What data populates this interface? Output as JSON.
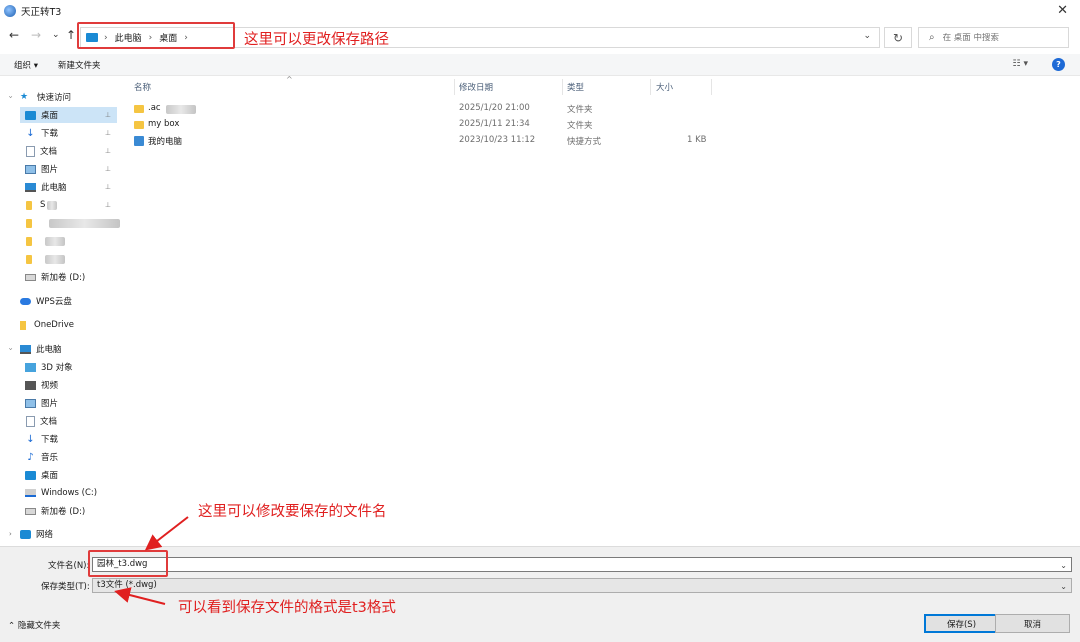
{
  "window": {
    "title": "天正转T3",
    "close_glyph": "✕"
  },
  "nav": {
    "back": "←",
    "forward": "→",
    "recent": "⌄",
    "up": "↑",
    "refresh": "↻"
  },
  "address": {
    "crumbs": [
      "此电脑",
      "桌面"
    ],
    "sep": "›",
    "dropdown": "⌄"
  },
  "search": {
    "placeholder": "在 桌面 中搜索",
    "icon": "⌕"
  },
  "annotations": {
    "path": "这里可以更改保存路径",
    "filename": "这里可以修改要保存的文件名",
    "format": "可以看到保存文件的格式是t3格式"
  },
  "toolbar": {
    "organize": "组织 ▾",
    "new_folder": "新建文件夹",
    "view": "☷ ▾",
    "help": "?"
  },
  "sidebar": {
    "quick_access": "快速访问",
    "quick_items": [
      "桌面",
      "下载",
      "文档",
      "图片",
      "此电脑",
      "S",
      "",
      "",
      ""
    ],
    "drive_d_1": "新加卷 (D:)",
    "wps": "WPS云盘",
    "onedrive": "OneDrive",
    "this_pc": "此电脑",
    "pc_items": [
      "3D 对象",
      "视频",
      "图片",
      "文档",
      "下载",
      "音乐",
      "桌面",
      "Windows (C:)",
      "新加卷 (D:)"
    ],
    "network": "网络",
    "pin_glyph": "📌",
    "chevron_glyph": "›"
  },
  "columns": {
    "name": "名称",
    "date": "修改日期",
    "type": "类型",
    "size": "大小",
    "sort_glyph": "^"
  },
  "files": [
    {
      "name": ".ac",
      "date": "2025/1/20 21:00",
      "type": "文件夹",
      "size": ""
    },
    {
      "name": "my box",
      "date": "2025/1/11 21:34",
      "type": "文件夹",
      "size": ""
    },
    {
      "name": "我的电脑",
      "date": "2023/10/23 11:12",
      "type": "快捷方式",
      "size": "1 KB"
    }
  ],
  "form": {
    "filename_label": "文件名(N):",
    "filename_value": "园林_t3.dwg",
    "filetype_label": "保存类型(T):",
    "filetype_value": "t3文件 (*.dwg)",
    "dropdown_glyph": "⌄",
    "hide_folders": "⌃ 隐藏文件夹",
    "save": "保存(S)",
    "cancel": "取消"
  }
}
